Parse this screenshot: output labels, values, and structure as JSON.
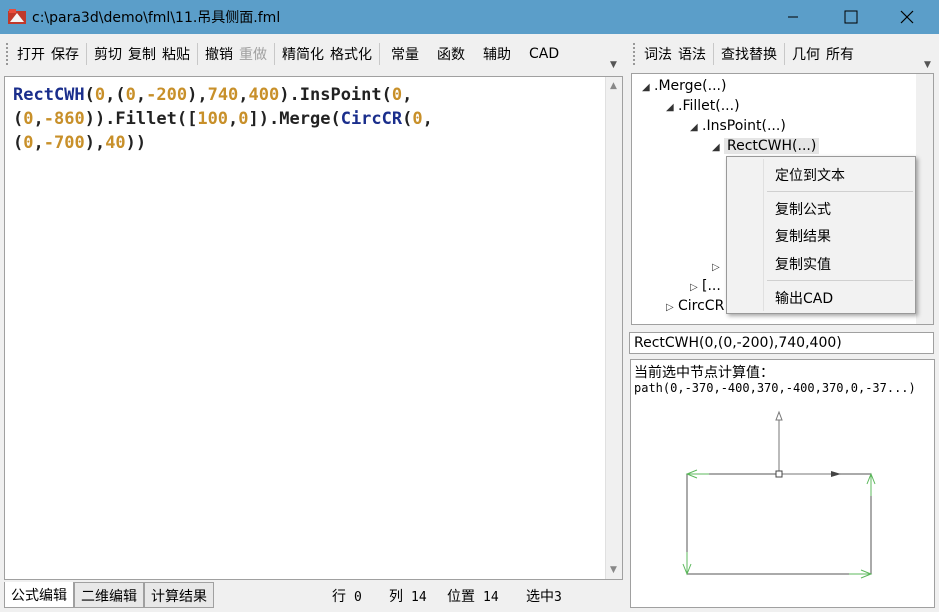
{
  "window": {
    "title": "c:\\para3d\\demo\\fml\\11.吊具侧面.fml",
    "minimize_icon": "minimize-icon",
    "maximize_icon": "maximize-icon",
    "close_icon": "close-icon"
  },
  "toolbar_left": {
    "open": "打开",
    "save": "保存",
    "cut": "剪切",
    "copy": "复制",
    "paste": "粘贴",
    "undo": "撤销",
    "redo": "重做",
    "simplify": "精简化",
    "format": "格式化",
    "constant": "常量",
    "function": "函数",
    "assist": "辅助",
    "cad": "CAD"
  },
  "toolbar_right": {
    "lexical": "词法",
    "syntax": "语法",
    "find_replace": "查找替换",
    "geometry": "几何",
    "all": "所有"
  },
  "editor": {
    "tokens": [
      {
        "t": "RectCWH",
        "c": "fn"
      },
      {
        "t": "(",
        "c": "punc"
      },
      {
        "t": "0",
        "c": "num"
      },
      {
        "t": ",(",
        "c": "punc"
      },
      {
        "t": "0",
        "c": "num"
      },
      {
        "t": ",",
        "c": "punc"
      },
      {
        "t": "-200",
        "c": "num"
      },
      {
        "t": "),",
        "c": "punc"
      },
      {
        "t": "740",
        "c": "num"
      },
      {
        "t": ",",
        "c": "punc"
      },
      {
        "t": "400",
        "c": "num"
      },
      {
        "t": ").",
        "c": "punc"
      },
      {
        "t": "InsPoint",
        "c": "meth"
      },
      {
        "t": "(",
        "c": "punc"
      },
      {
        "t": "0",
        "c": "num"
      },
      {
        "t": ",\n(",
        "c": "punc"
      },
      {
        "t": "0",
        "c": "num"
      },
      {
        "t": ",",
        "c": "punc"
      },
      {
        "t": "-860",
        "c": "num"
      },
      {
        "t": ")).",
        "c": "punc"
      },
      {
        "t": "Fillet",
        "c": "meth"
      },
      {
        "t": "([",
        "c": "punc"
      },
      {
        "t": "100",
        "c": "num"
      },
      {
        "t": ",",
        "c": "punc"
      },
      {
        "t": "0",
        "c": "num"
      },
      {
        "t": "]).",
        "c": "punc"
      },
      {
        "t": "Merge",
        "c": "meth"
      },
      {
        "t": "(",
        "c": "punc"
      },
      {
        "t": "CircCR",
        "c": "fn"
      },
      {
        "t": "(",
        "c": "punc"
      },
      {
        "t": "0",
        "c": "num"
      },
      {
        "t": ",\n(",
        "c": "punc"
      },
      {
        "t": "0",
        "c": "num"
      },
      {
        "t": ",",
        "c": "punc"
      },
      {
        "t": "-700",
        "c": "num"
      },
      {
        "t": "),",
        "c": "punc"
      },
      {
        "t": "40",
        "c": "num"
      },
      {
        "t": "))",
        "c": "punc"
      }
    ]
  },
  "bottom_tabs": {
    "formula_edit": "公式编辑",
    "edit_2d": "二维编辑",
    "calc_result": "计算结果"
  },
  "status": {
    "row_label": "行",
    "row_value": "0",
    "col_label": "列",
    "col_value": "14",
    "pos_label": "位置",
    "pos_value": "14",
    "sel_label": "选中",
    "sel_value": "3"
  },
  "tree": {
    "merge": ".Merge(...)",
    "fillet": ".Fillet(...)",
    "inspoint": ".InsPoint(...)",
    "rectcwh": "RectCWH(...)",
    "bracket": "[...",
    "circ": "CircCR"
  },
  "context_menu": {
    "locate_text": "定位到文本",
    "copy_formula": "复制公式",
    "copy_result": "复制结果",
    "copy_value": "复制实值",
    "output_cad": "输出CAD"
  },
  "formula_box": "RectCWH(0,(0,-200),740,400)",
  "preview": {
    "title": "当前选中节点计算值：",
    "value": "path(0,-370,-400,370,-400,370,0,-37...)"
  },
  "colors": {
    "titlebar": "#5b9ec9",
    "function_token": "#1a2e8c",
    "number_token": "#c8902a",
    "preview_arrow": "#5cb85c"
  }
}
